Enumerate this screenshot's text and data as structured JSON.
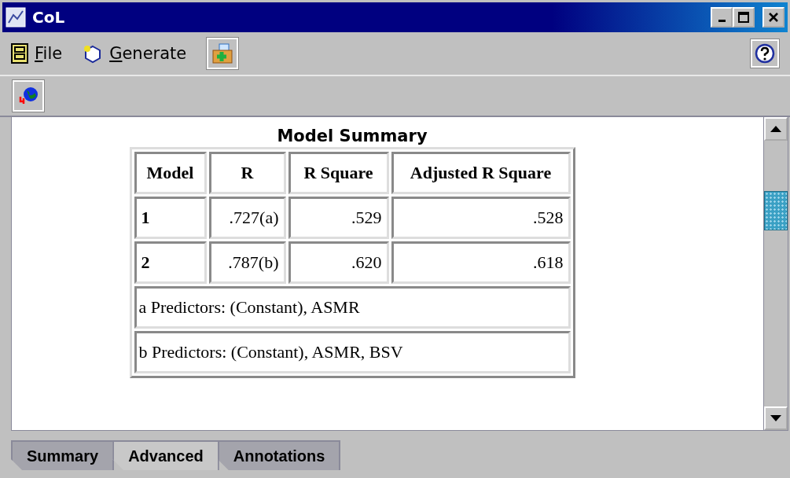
{
  "window": {
    "title": "CoL"
  },
  "menu": [
    {
      "label": "File"
    },
    {
      "label": "Generate"
    }
  ],
  "report": {
    "title": "Model Summary",
    "columns": [
      "Model",
      "R",
      "R Square",
      "Adjusted R Square"
    ],
    "rows": [
      [
        "1",
        ".727(a)",
        ".529",
        ".528"
      ],
      [
        "2",
        ".787(b)",
        ".620",
        ".618"
      ]
    ],
    "footnotes": [
      "a Predictors: (Constant), ASMR",
      "b Predictors: (Constant), ASMR, BSV"
    ]
  },
  "tabs": [
    {
      "label": "Summary",
      "selected": false
    },
    {
      "label": "Advanced",
      "selected": true
    },
    {
      "label": "Annotations",
      "selected": false
    }
  ]
}
